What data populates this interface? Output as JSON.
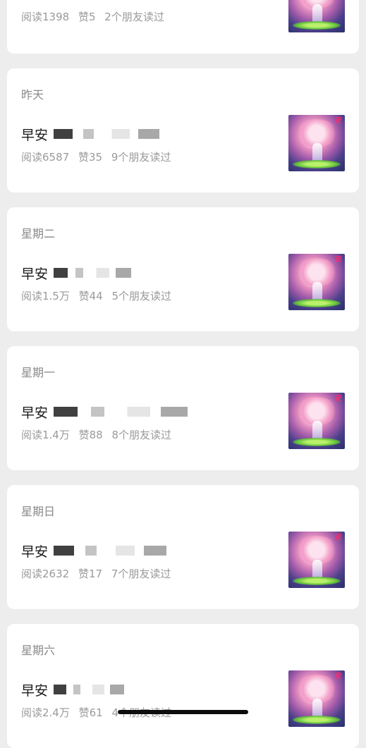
{
  "articles": [
    {
      "date": "",
      "title": "",
      "reads": "阅读1398",
      "likes": "赞5",
      "friends": "2个朋友读过",
      "thumb_badge": ""
    },
    {
      "date": "昨天",
      "title": "早安",
      "reads": "阅读6587",
      "likes": "赞35",
      "friends": "9个朋友读过",
      "thumb_badge": "安"
    },
    {
      "date": "星期二",
      "title": "早安",
      "reads": "阅读1.5万",
      "likes": "赞44",
      "friends": "5个朋友读过",
      "thumb_badge": "安"
    },
    {
      "date": "星期一",
      "title": "早安",
      "reads": "阅读1.4万",
      "likes": "赞88",
      "friends": "8个朋友读过",
      "thumb_badge": "安"
    },
    {
      "date": "星期日",
      "title": "早安",
      "reads": "阅读2632",
      "likes": "赞17",
      "friends": "7个朋友读过",
      "thumb_badge": "安"
    },
    {
      "date": "星期六",
      "title": "早安",
      "reads": "阅读2.4万",
      "likes": "赞61",
      "friends": "4个朋友读过",
      "thumb_badge": "安"
    }
  ]
}
